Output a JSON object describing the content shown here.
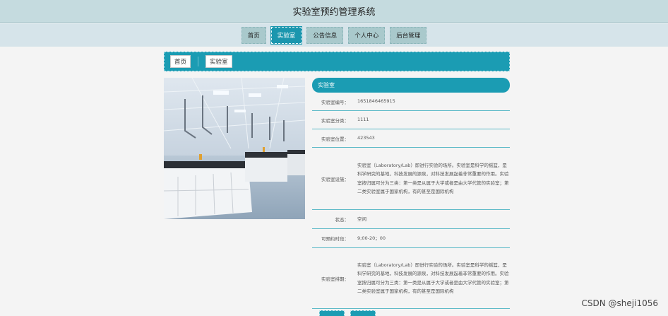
{
  "header": {
    "title": "实验室预约管理系统"
  },
  "nav": [
    {
      "label": "首页",
      "active": false
    },
    {
      "label": "实验室",
      "active": true
    },
    {
      "label": "公告信息",
      "active": false
    },
    {
      "label": "个人中心",
      "active": false
    },
    {
      "label": "后台管理",
      "active": false
    }
  ],
  "breadcrumb": {
    "home": "首页",
    "current": "实验室"
  },
  "detail": {
    "heading": "实验室",
    "fields": {
      "number": {
        "label": "实验室编号：",
        "value": "1651846465915"
      },
      "category": {
        "label": "实验室分类：",
        "value": "1111"
      },
      "location": {
        "label": "实验室位置：",
        "value": "423543"
      },
      "facilities": {
        "label": "实验室设施：",
        "value": "实验室（Laboratory/Lab）即进行实验的场所。实验室是科学的摇篮，是科学研究的基地，科技发展的源泉，对科技发展起着非常重要的作用。实验室按归属可分为三类：第一类是从属于大学或者是由大学代管的实验室；第二类实验室属于国家机构，有的甚至是国际机构"
      },
      "status": {
        "label": "状态：",
        "value": "空闲"
      },
      "bookable_time": {
        "label": "可预约时段：",
        "value": "9;00-20；00"
      },
      "arrangement": {
        "label": "实验室排期：",
        "value": "实验室（Laboratory/Lab）即进行实验的场所。实验室是科学的摇篮，是科学研究的基地，科技发展的源泉，对科技发展起着非常重要的作用。实验室按归属可分为三类：第一类是从属于大学或者是由大学代管的实验室；第二类实验室属于国家机构，有的甚至是国际机构"
      }
    }
  },
  "watermark": "CSDN @sheji1056",
  "colors": {
    "primary": "#1b9cb3",
    "header_bg": "#c5dbdf",
    "nav_bg": "#d6e4ea",
    "nav_item": "#a9c9cc",
    "page_bg": "#f4f4f4"
  }
}
